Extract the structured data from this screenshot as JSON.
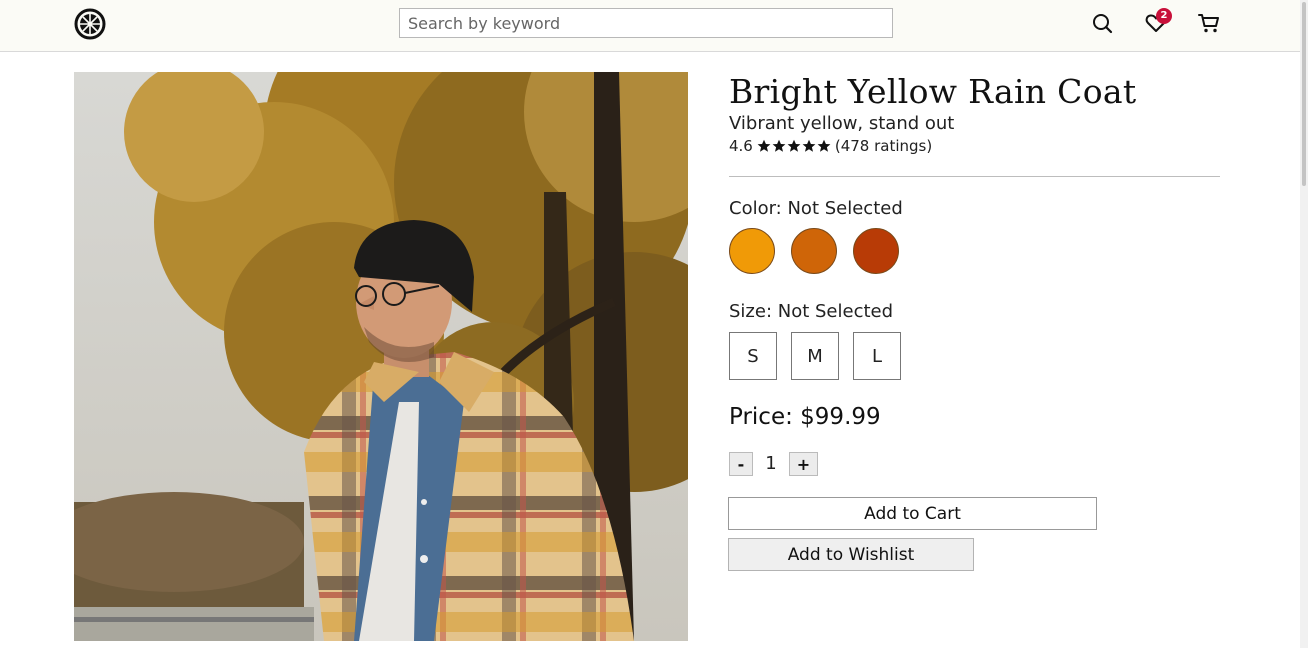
{
  "header": {
    "search": {
      "placeholder": "Search by keyword",
      "value": ""
    },
    "wishlist_count": "2",
    "icons": [
      "logo-icon",
      "search-icon",
      "heart-icon",
      "cart-icon"
    ]
  },
  "product": {
    "title": "Bright Yellow Rain Coat",
    "subtitle": "Vibrant yellow, stand out",
    "rating": "4.6",
    "stars": 5,
    "ratings_count": "(478 ratings)",
    "color_label": "Color: Not Selected",
    "colors": [
      "#f09a07",
      "#cf6508",
      "#b83b06"
    ],
    "size_label": "Size: Not Selected",
    "sizes": [
      "S",
      "M",
      "L"
    ],
    "price": "Price: $99.99",
    "quantity": {
      "minus": "-",
      "value": "1",
      "plus": "+"
    },
    "add_to_cart": "Add to Cart",
    "add_to_wishlist": "Add to Wishlist"
  }
}
